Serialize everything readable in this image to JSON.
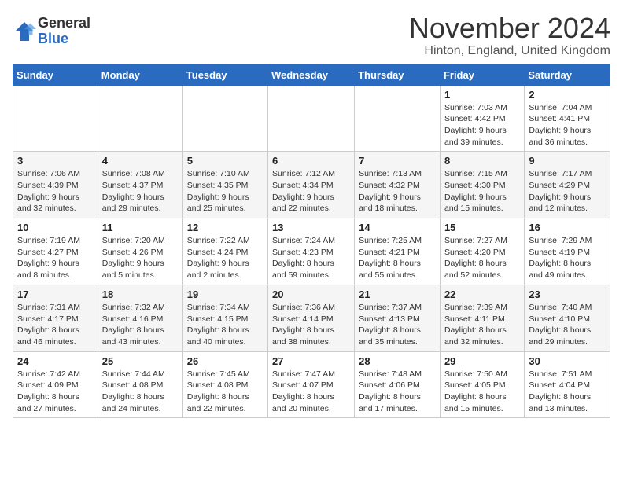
{
  "header": {
    "logo_general": "General",
    "logo_blue": "Blue",
    "month_title": "November 2024",
    "location": "Hinton, England, United Kingdom"
  },
  "weekdays": [
    "Sunday",
    "Monday",
    "Tuesday",
    "Wednesday",
    "Thursday",
    "Friday",
    "Saturday"
  ],
  "weeks": [
    [
      {
        "day": "",
        "info": ""
      },
      {
        "day": "",
        "info": ""
      },
      {
        "day": "",
        "info": ""
      },
      {
        "day": "",
        "info": ""
      },
      {
        "day": "",
        "info": ""
      },
      {
        "day": "1",
        "info": "Sunrise: 7:03 AM\nSunset: 4:42 PM\nDaylight: 9 hours\nand 39 minutes."
      },
      {
        "day": "2",
        "info": "Sunrise: 7:04 AM\nSunset: 4:41 PM\nDaylight: 9 hours\nand 36 minutes."
      }
    ],
    [
      {
        "day": "3",
        "info": "Sunrise: 7:06 AM\nSunset: 4:39 PM\nDaylight: 9 hours\nand 32 minutes."
      },
      {
        "day": "4",
        "info": "Sunrise: 7:08 AM\nSunset: 4:37 PM\nDaylight: 9 hours\nand 29 minutes."
      },
      {
        "day": "5",
        "info": "Sunrise: 7:10 AM\nSunset: 4:35 PM\nDaylight: 9 hours\nand 25 minutes."
      },
      {
        "day": "6",
        "info": "Sunrise: 7:12 AM\nSunset: 4:34 PM\nDaylight: 9 hours\nand 22 minutes."
      },
      {
        "day": "7",
        "info": "Sunrise: 7:13 AM\nSunset: 4:32 PM\nDaylight: 9 hours\nand 18 minutes."
      },
      {
        "day": "8",
        "info": "Sunrise: 7:15 AM\nSunset: 4:30 PM\nDaylight: 9 hours\nand 15 minutes."
      },
      {
        "day": "9",
        "info": "Sunrise: 7:17 AM\nSunset: 4:29 PM\nDaylight: 9 hours\nand 12 minutes."
      }
    ],
    [
      {
        "day": "10",
        "info": "Sunrise: 7:19 AM\nSunset: 4:27 PM\nDaylight: 9 hours\nand 8 minutes."
      },
      {
        "day": "11",
        "info": "Sunrise: 7:20 AM\nSunset: 4:26 PM\nDaylight: 9 hours\nand 5 minutes."
      },
      {
        "day": "12",
        "info": "Sunrise: 7:22 AM\nSunset: 4:24 PM\nDaylight: 9 hours\nand 2 minutes."
      },
      {
        "day": "13",
        "info": "Sunrise: 7:24 AM\nSunset: 4:23 PM\nDaylight: 8 hours\nand 59 minutes."
      },
      {
        "day": "14",
        "info": "Sunrise: 7:25 AM\nSunset: 4:21 PM\nDaylight: 8 hours\nand 55 minutes."
      },
      {
        "day": "15",
        "info": "Sunrise: 7:27 AM\nSunset: 4:20 PM\nDaylight: 8 hours\nand 52 minutes."
      },
      {
        "day": "16",
        "info": "Sunrise: 7:29 AM\nSunset: 4:19 PM\nDaylight: 8 hours\nand 49 minutes."
      }
    ],
    [
      {
        "day": "17",
        "info": "Sunrise: 7:31 AM\nSunset: 4:17 PM\nDaylight: 8 hours\nand 46 minutes."
      },
      {
        "day": "18",
        "info": "Sunrise: 7:32 AM\nSunset: 4:16 PM\nDaylight: 8 hours\nand 43 minutes."
      },
      {
        "day": "19",
        "info": "Sunrise: 7:34 AM\nSunset: 4:15 PM\nDaylight: 8 hours\nand 40 minutes."
      },
      {
        "day": "20",
        "info": "Sunrise: 7:36 AM\nSunset: 4:14 PM\nDaylight: 8 hours\nand 38 minutes."
      },
      {
        "day": "21",
        "info": "Sunrise: 7:37 AM\nSunset: 4:13 PM\nDaylight: 8 hours\nand 35 minutes."
      },
      {
        "day": "22",
        "info": "Sunrise: 7:39 AM\nSunset: 4:11 PM\nDaylight: 8 hours\nand 32 minutes."
      },
      {
        "day": "23",
        "info": "Sunrise: 7:40 AM\nSunset: 4:10 PM\nDaylight: 8 hours\nand 29 minutes."
      }
    ],
    [
      {
        "day": "24",
        "info": "Sunrise: 7:42 AM\nSunset: 4:09 PM\nDaylight: 8 hours\nand 27 minutes."
      },
      {
        "day": "25",
        "info": "Sunrise: 7:44 AM\nSunset: 4:08 PM\nDaylight: 8 hours\nand 24 minutes."
      },
      {
        "day": "26",
        "info": "Sunrise: 7:45 AM\nSunset: 4:08 PM\nDaylight: 8 hours\nand 22 minutes."
      },
      {
        "day": "27",
        "info": "Sunrise: 7:47 AM\nSunset: 4:07 PM\nDaylight: 8 hours\nand 20 minutes."
      },
      {
        "day": "28",
        "info": "Sunrise: 7:48 AM\nSunset: 4:06 PM\nDaylight: 8 hours\nand 17 minutes."
      },
      {
        "day": "29",
        "info": "Sunrise: 7:50 AM\nSunset: 4:05 PM\nDaylight: 8 hours\nand 15 minutes."
      },
      {
        "day": "30",
        "info": "Sunrise: 7:51 AM\nSunset: 4:04 PM\nDaylight: 8 hours\nand 13 minutes."
      }
    ]
  ]
}
